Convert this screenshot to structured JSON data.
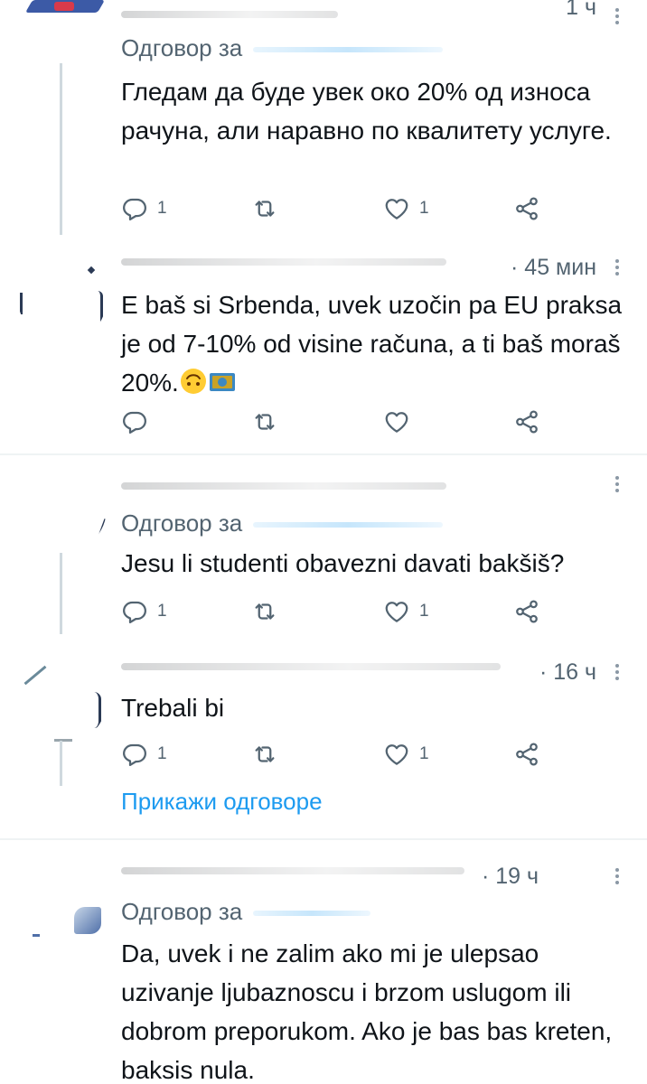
{
  "tweets": [
    {
      "time": "1 ч",
      "reply_prefix": "Одговор за",
      "text": "Гледам да буде увек око 20% од износа рачуна, али наравно по квалитету услуге.",
      "reply_count": "1",
      "like_count": "1"
    },
    {
      "time": "· 45 мин",
      "text": "E baš si Srbenda, uvek uzočin pa EU praksa je od 7-10% od visine računa,  a ti baš moraš 20%.",
      "emoji": [
        "upside-down-face",
        "euro-banknote"
      ]
    },
    {
      "reply_prefix": "Одговор за",
      "text": "Jesu li studenti obavezni davati bakšiš?",
      "reply_count": "1",
      "like_count": "1"
    },
    {
      "time": "· 16 ч",
      "text": "Trebali bi",
      "reply_count": "1",
      "like_count": "1",
      "show_replies": "Прикажи одговоре"
    },
    {
      "time": "· 19 ч",
      "reply_prefix": "Одговор за",
      "text": "Da, uvek i ne zalim ako mi je ulepsao uzivanje ljubaznoscu i brzom uslugom ili dobrom preporukom. Ako je bas bas kreten, baksis nula."
    }
  ],
  "icons": {
    "reply": "reply-icon",
    "retweet": "retweet-icon",
    "like": "heart-icon",
    "share": "share-icon",
    "more": "more-icon"
  },
  "colors": {
    "text": "#0f1419",
    "secondary": "#536471",
    "accent": "#1d9bf0",
    "divider": "#eff3f4",
    "thread_line": "#cfd9de"
  }
}
